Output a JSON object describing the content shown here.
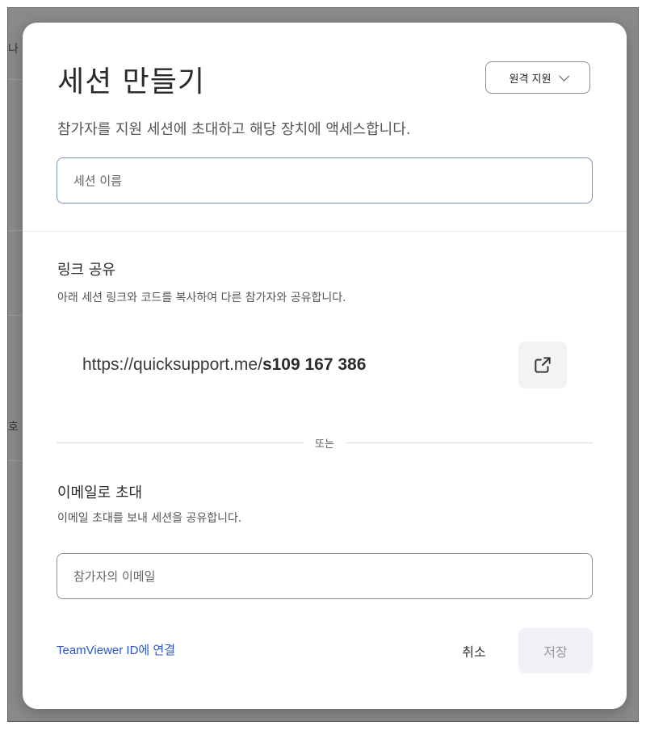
{
  "background": {
    "left_text_1": "나",
    "left_text_2": "호"
  },
  "dialog": {
    "title": "세션 만들기",
    "mode_select": {
      "selected": "원격 지원",
      "icon": "chevron-down-icon"
    },
    "subtitle": "참가자를 지원 세션에 초대하고 해당 장치에 액세스합니다.",
    "session_name": {
      "placeholder": "세션 이름",
      "value": ""
    },
    "share_link": {
      "title": "링크 공유",
      "description": "아래 세션 링크와 코드를 복사하여 다른 참가자와 공유합니다.",
      "url_prefix": "https://quicksupport.me/",
      "code": "s109 167 386",
      "share_icon": "share-icon"
    },
    "or_label": "또는",
    "email_invite": {
      "title": "이메일로 초대",
      "description": "이메일 초대를 보내 세션을 공유합니다.",
      "placeholder": "참가자의 이메일",
      "value": ""
    },
    "footer": {
      "link_label": "TeamViewer ID에 연결",
      "cancel_label": "취소",
      "save_label": "저장"
    }
  },
  "colors": {
    "accent_link": "#2c56c9",
    "focused_border": "#7b90c0",
    "save_bg": "#f1f1f7"
  }
}
